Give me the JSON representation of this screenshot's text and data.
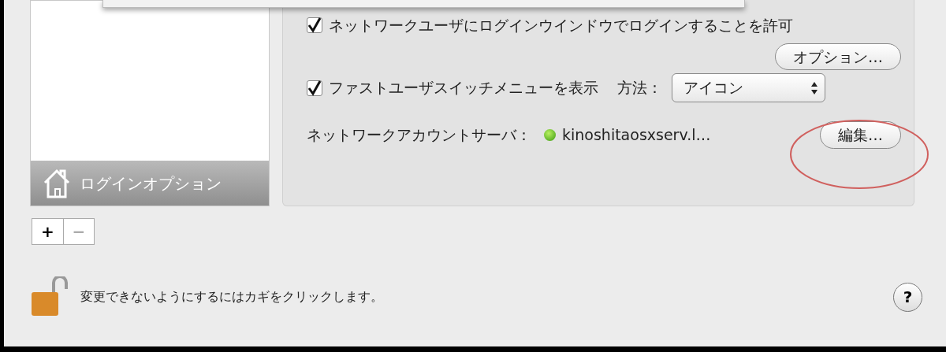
{
  "list": {
    "items": [
      {
        "label": "ログインオプション",
        "selected": true
      }
    ]
  },
  "allow_network_login": {
    "label": "ネットワークユーザにログインウインドウでログインすることを許可",
    "checked": true
  },
  "options_button": "オプション…",
  "fast_user_switch": {
    "label": "ファストユーザスイッチメニューを表示",
    "checked": true,
    "method_label": "方法：",
    "method_value": "アイコン"
  },
  "network_server": {
    "label": "ネットワークアカウントサーバ：",
    "connected": true,
    "server": "kinoshitaosxserv.l…",
    "edit_button": "編集…"
  },
  "list_buttons": [
    "+",
    "−"
  ],
  "lock_text": "変更できないようにするにはカギをクリックします。",
  "help_button": "?"
}
